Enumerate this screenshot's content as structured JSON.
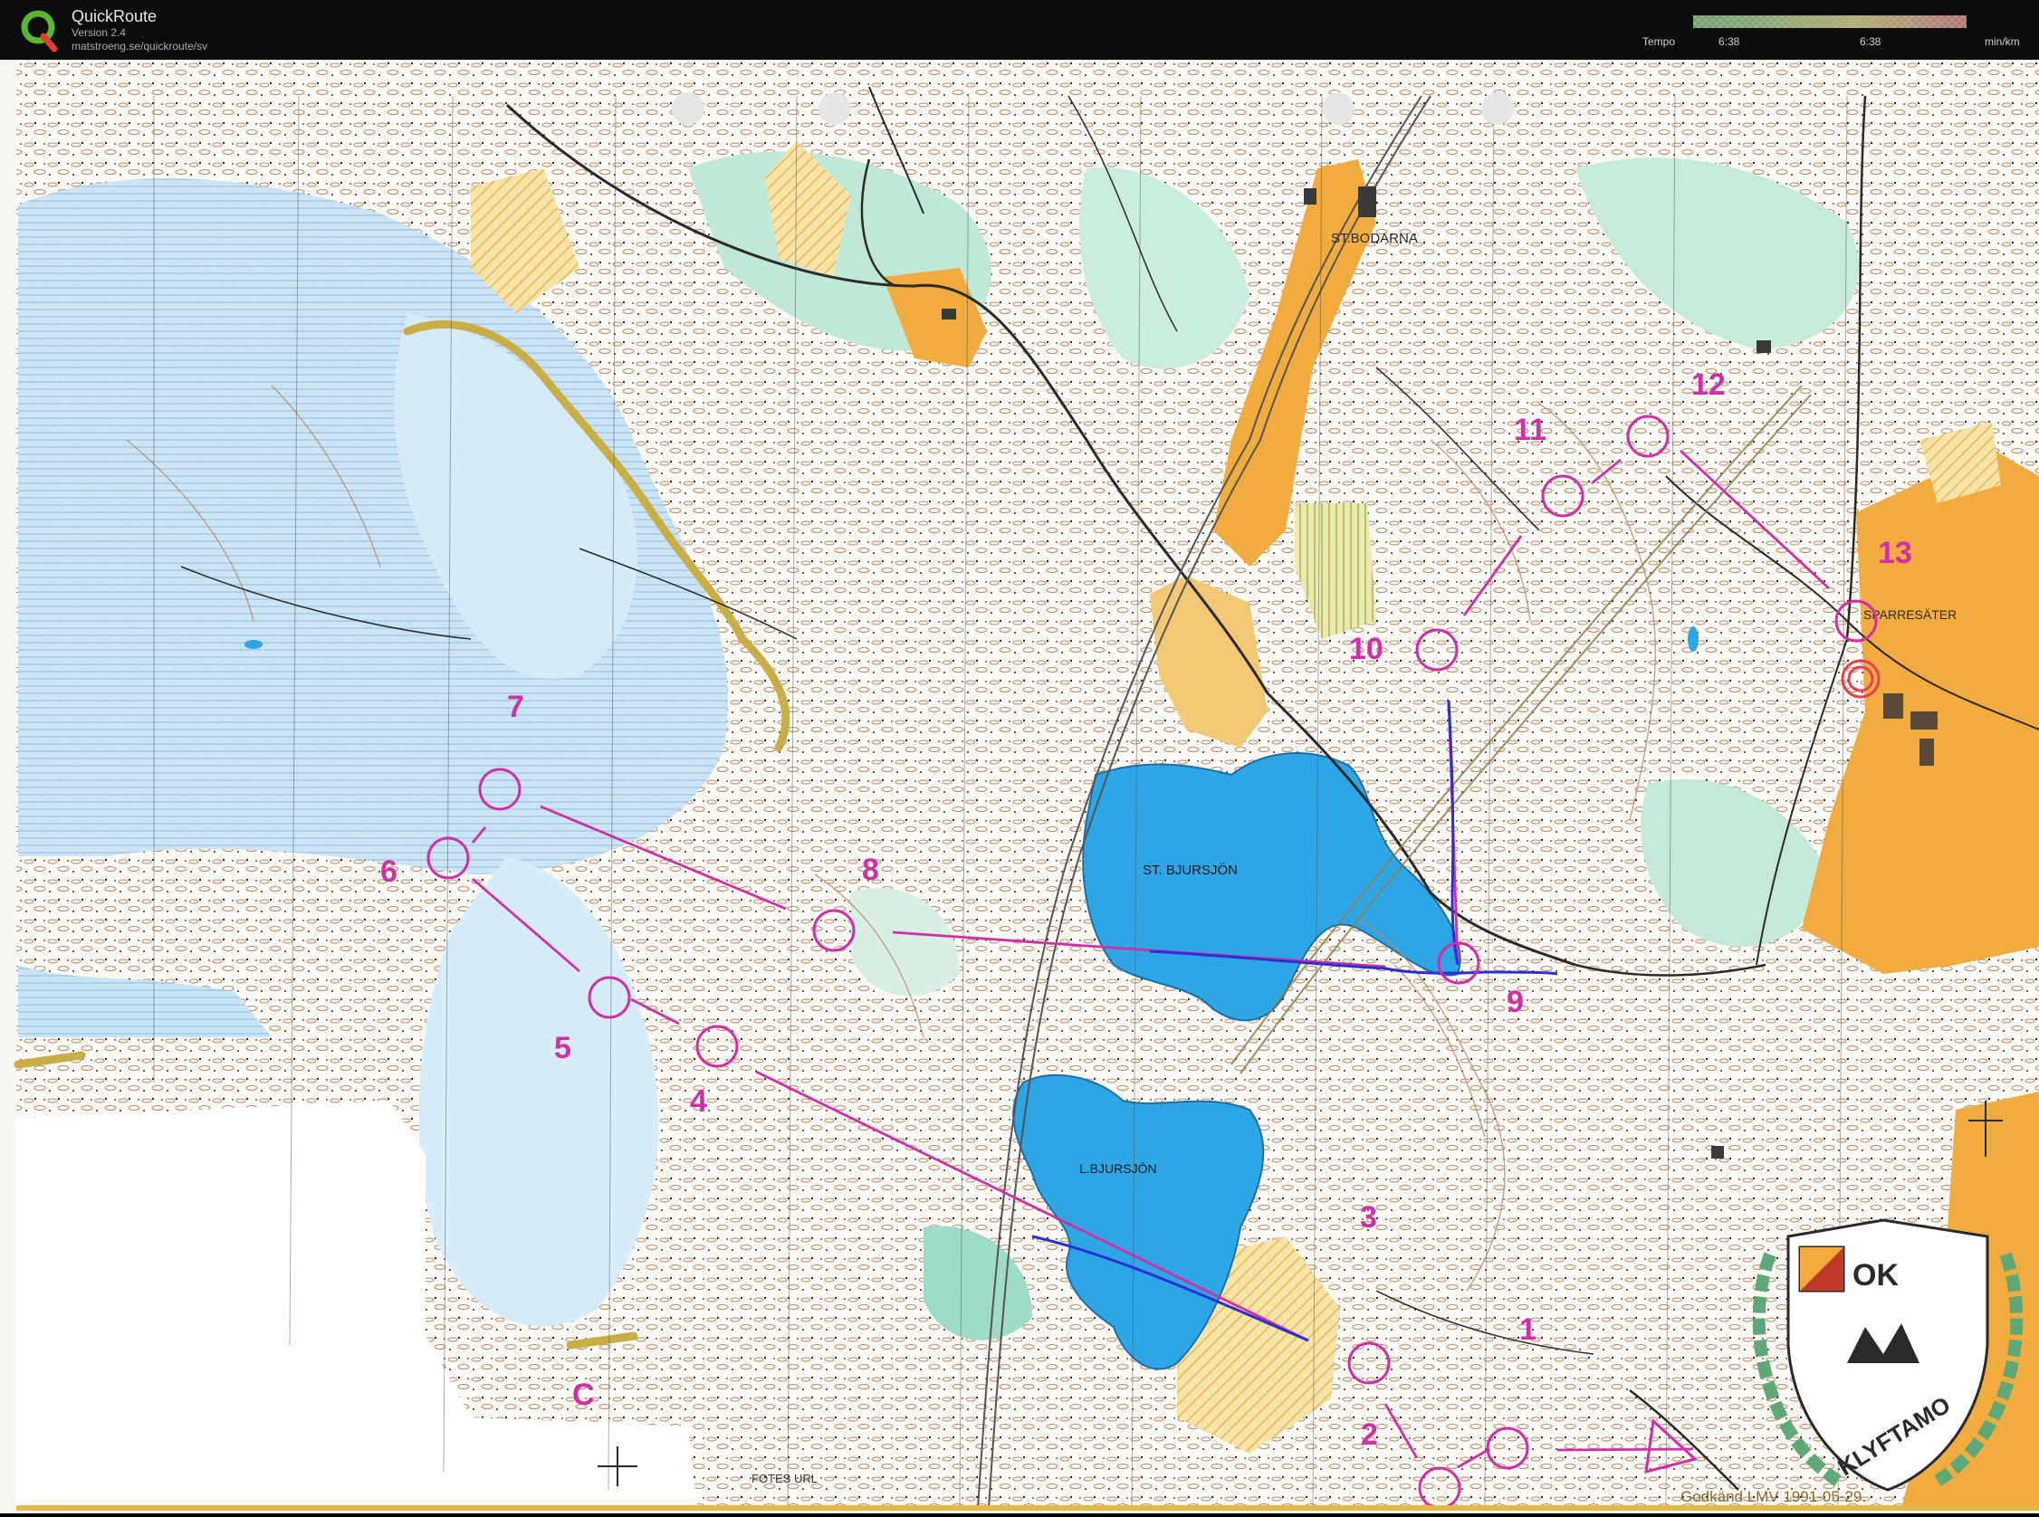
{
  "app": {
    "title": "QuickRoute",
    "version": "Version 2.4",
    "url": "matstroeng.se/quickroute/sv"
  },
  "tempo": {
    "label": "Tempo",
    "scale_left": "6:38",
    "scale_right": "6:38",
    "unit": "min/km"
  },
  "map": {
    "place_labels": {
      "st_bodarna": "ST.BODARNA",
      "sparresater": "SPARRESÄTER",
      "st_bjursjon": "ST. BJURSJÖN",
      "l_bjursjon": "L.BJURSJÖN",
      "fotes_url": "FOTES URL"
    },
    "controls": [
      "1",
      "2",
      "3",
      "4",
      "5",
      "6",
      "7",
      "8",
      "9",
      "10",
      "11",
      "12",
      "13"
    ],
    "map_letter": "C",
    "footer_text": "Godkänd LMV 1991-05-29.",
    "club_logo_text": "KLYFTAMO",
    "club_logo_initials": "OK"
  },
  "colors": {
    "course": "#d12fa6",
    "route": "#2b2fd4",
    "lake": "#2ea6e6",
    "marsh": "#b9dcf3",
    "field": "#f2ab3e",
    "green": "#9edcc8"
  }
}
